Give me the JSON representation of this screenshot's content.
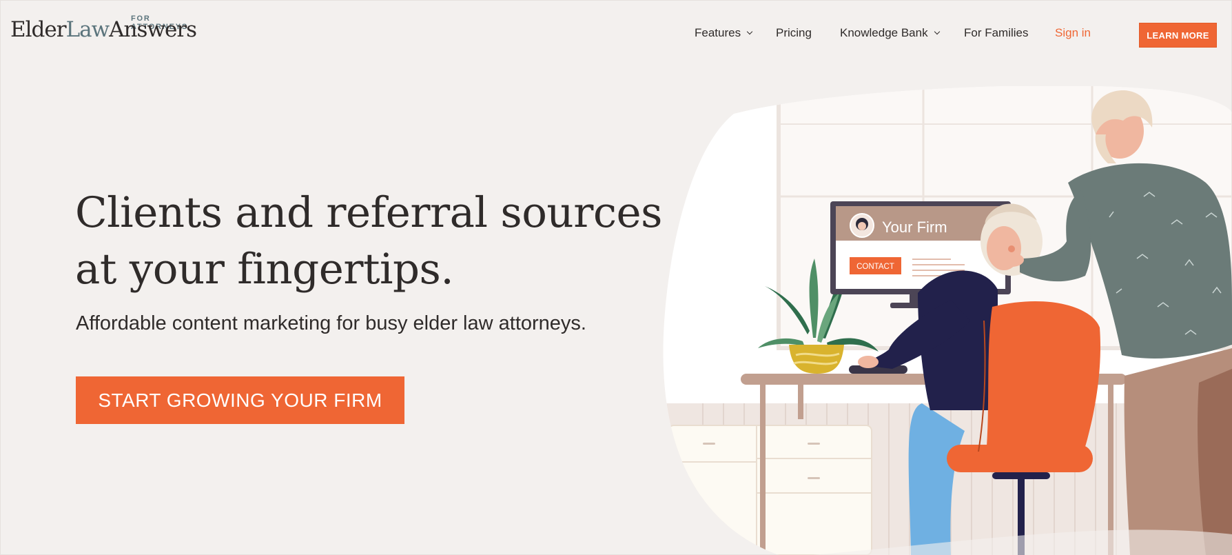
{
  "logo": {
    "tagline": "FOR ATTORNEYS",
    "word_elder": "Elder",
    "word_law": "Law",
    "word_answers": "Answers"
  },
  "nav": {
    "features": "Features",
    "pricing": "Pricing",
    "knowledge_bank": "Knowledge Bank",
    "for_families": "For Families",
    "sign_in": "Sign in",
    "learn_more": "LEARN MORE"
  },
  "hero": {
    "title_line1": "Clients and referral sources",
    "title_line2": "at your fingertips.",
    "subtitle": "Affordable content marketing for busy elder law attorneys.",
    "cta_label": "START GROWING YOUR FIRM"
  },
  "illustration": {
    "screen_title": "Your Firm",
    "screen_button": "CONTACT"
  },
  "colors": {
    "accent": "#ef6634",
    "logo_accent": "#5b747c",
    "background": "#f3f0ee",
    "text": "#2f2b2a"
  }
}
